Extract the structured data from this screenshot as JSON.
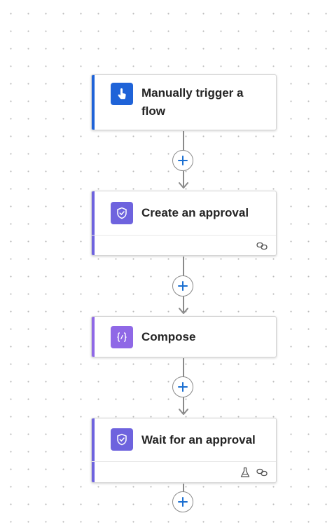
{
  "flow": {
    "steps": [
      {
        "title": "Manually trigger a flow",
        "icon": "hand-tap-icon",
        "accent": "#1f63d8",
        "icon_bg": "#1f63d8"
      },
      {
        "title": "Create an approval",
        "icon": "approval-icon",
        "accent": "#6e63de",
        "icon_bg": "#6e63de"
      },
      {
        "title": "Compose",
        "icon": "compose-icon",
        "accent": "#8f68e6",
        "icon_bg": "#8f68e6"
      },
      {
        "title": "Wait for an approval",
        "icon": "approval-icon",
        "accent": "#6e63de",
        "icon_bg": "#6e63de"
      }
    ],
    "add_button_color": "#1b6fd1"
  }
}
